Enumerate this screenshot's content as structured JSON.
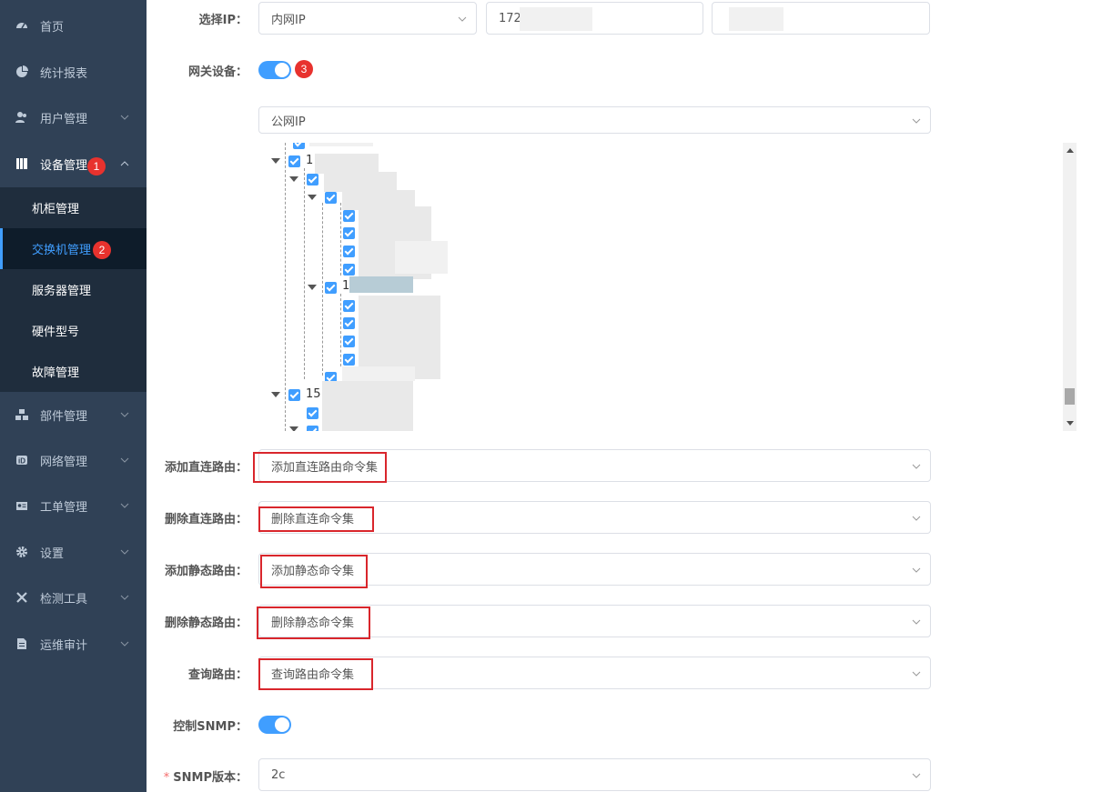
{
  "sidebar": {
    "items": [
      {
        "label": "首页",
        "icon": "dashboard-icon"
      },
      {
        "label": "统计报表",
        "icon": "pie-chart-icon"
      },
      {
        "label": "用户管理",
        "icon": "users-icon"
      },
      {
        "label": "设备管理",
        "icon": "book-icon",
        "badge": "1"
      },
      {
        "label": "部件管理",
        "icon": "cubes-icon"
      },
      {
        "label": "网络管理",
        "icon": "network-icon"
      },
      {
        "label": "工单管理",
        "icon": "id-card-icon"
      },
      {
        "label": "设置",
        "icon": "gear-icon"
      },
      {
        "label": "检测工具",
        "icon": "tools-icon"
      },
      {
        "label": "运维审计",
        "icon": "audit-icon"
      }
    ],
    "submenu": [
      {
        "label": "机柜管理"
      },
      {
        "label": "交换机管理",
        "badge": "2"
      },
      {
        "label": "服务器管理"
      },
      {
        "label": "硬件型号"
      },
      {
        "label": "故障管理"
      }
    ]
  },
  "form": {
    "select_ip": {
      "label": "选择IP：",
      "type_value": "内网IP",
      "ip_value": "172"
    },
    "gateway": {
      "label": "网关设备：",
      "badge": "3",
      "enabled": true,
      "select_value": "公网IP"
    },
    "tree": {
      "node_15_prefix": "15",
      "node_1_prefix": "1"
    },
    "routes": [
      {
        "label": "添加直连路由：",
        "value": "添加直连路由命令集"
      },
      {
        "label": "删除直连路由：",
        "value": "删除直连命令集"
      },
      {
        "label": "添加静态路由：",
        "value": "添加静态命令集"
      },
      {
        "label": "删除静态路由：",
        "value": "删除静态命令集"
      },
      {
        "label": "查询路由：",
        "value": "查询路由命令集"
      }
    ],
    "snmp_control": {
      "label": "控制SNMP：",
      "enabled": true
    },
    "snmp_version": {
      "required_mark": "*",
      "label": "SNMP版本：",
      "value": "2c"
    }
  },
  "colors": {
    "sidebar_bg": "#304156",
    "submenu_bg": "#1f2d3d",
    "accent": "#409eff",
    "badge": "#e8322e",
    "highlight_box": "#d9262c"
  }
}
